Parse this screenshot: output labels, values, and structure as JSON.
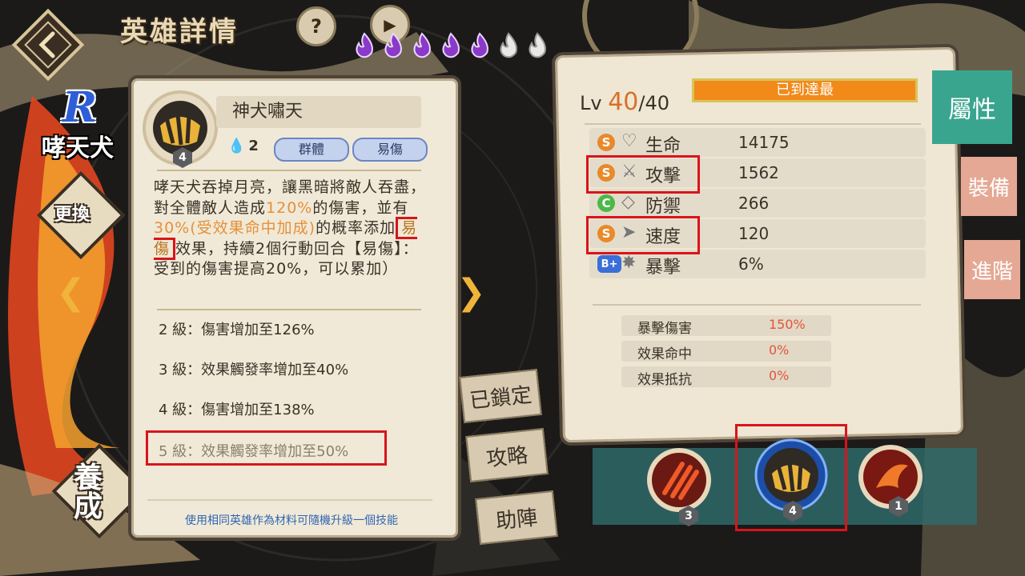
{
  "header": {
    "title": "英雄詳情",
    "help_icon": "question-icon",
    "play_icon": "play-icon"
  },
  "hero": {
    "rarity": "R",
    "name": "哮天犬",
    "awaken_stars": {
      "filled": 5,
      "total": 7
    }
  },
  "left_actions": {
    "swap_label": "更換",
    "train_label": "養成"
  },
  "skill": {
    "name": "神犬嘯天",
    "level_badge": "4",
    "cost": "2",
    "tags": [
      "群體",
      "易傷"
    ],
    "desc_parts": {
      "p1": "哮天犬吞掉月亮，讓黑暗將敵人吞盡，對全體敵人造成",
      "p2": "120%",
      "p3": "的傷害，並有",
      "p4": "30%(受效果命中加成)",
      "p5": "的概率添加",
      "p6": "易傷",
      "p7": "效果，持續2個行動回合【易傷】：受到的傷害提高20%，可以累加）"
    },
    "levels": [
      "2 級：傷害增加至126%",
      "3 級：效果觸發率增加至40%",
      "4 級：傷害增加至138%",
      "5 級：效果觸發率增加至50%"
    ],
    "hint": "使用相同英雄作為材料可隨機升級一個技能"
  },
  "middle_tabs": [
    "已鎖定",
    "攻略",
    "助陣"
  ],
  "stats": {
    "level_prefix": "Lv",
    "level": "40",
    "level_max": "/40",
    "max_label": "已到達最",
    "rows": [
      {
        "grade": "S",
        "grade_color": "#e8892a",
        "icon": "heart-icon",
        "name": "生命",
        "value": "14175"
      },
      {
        "grade": "S",
        "grade_color": "#e8892a",
        "icon": "sword-icon",
        "name": "攻擊",
        "value": "1562"
      },
      {
        "grade": "C",
        "grade_color": "#4db84a",
        "icon": "shield-icon",
        "name": "防禦",
        "value": "266"
      },
      {
        "grade": "S",
        "grade_color": "#e8892a",
        "icon": "speed-icon",
        "name": "速度",
        "value": "120"
      },
      {
        "grade": "B+",
        "grade_color": "#3b6fd8",
        "icon": "crit-icon",
        "name": "暴擊",
        "value": "6%"
      }
    ],
    "sub": [
      {
        "name": "暴擊傷害",
        "value": "150%"
      },
      {
        "name": "效果命中",
        "value": "0%"
      },
      {
        "name": "效果抵抗",
        "value": "0%"
      }
    ]
  },
  "side_tabs": [
    {
      "label": "屬性",
      "color": "#3aa58e"
    },
    {
      "label": "裝備",
      "color": "#e4a894"
    },
    {
      "label": "進階",
      "color": "#e4a894"
    }
  ],
  "bottom_skills": [
    {
      "level": "3",
      "icon": "claw-skill-icon"
    },
    {
      "level": "4",
      "icon": "moon-skill-icon"
    },
    {
      "level": "1",
      "icon": "flame-skill-icon"
    }
  ],
  "colors": {
    "highlight": "#e4913a",
    "annot_red": "#d9141b",
    "accent_teal": "#3aa58e",
    "rarity_blue": "#2f5fd8"
  }
}
